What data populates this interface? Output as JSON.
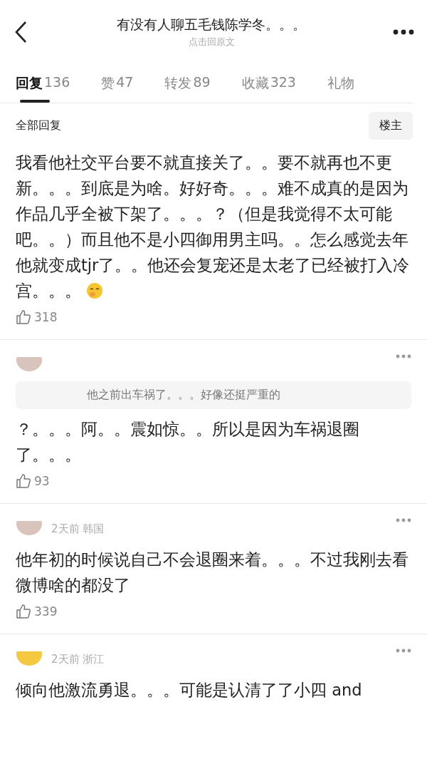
{
  "header": {
    "title": "有没有人聊五毛钱陈学冬。。。",
    "subtitle": "点击回原文"
  },
  "tabs": [
    {
      "label": "回复",
      "count": "136",
      "selected": true
    },
    {
      "label": "赞",
      "count": "47",
      "selected": false
    },
    {
      "label": "转发",
      "count": "89",
      "selected": false
    },
    {
      "label": "收藏",
      "count": "323",
      "selected": false
    },
    {
      "label": "礼物",
      "selected": false
    }
  ],
  "filter": {
    "label": "全部回复",
    "button": "楼主"
  },
  "comments": [
    {
      "text": "我看他社交平台要不就直接关了。。要不就再也不更新。。。到底是为啥。好好奇。。。难不成真的是因为作品几乎全被下架了。。。？（但是我觉得不太可能吧。。）而且他不是小四御用男主吗。。怎么感觉去年他就变成tjr了。。他还会复宠还是太老了已经被打入冷宫。。。",
      "emoji": true,
      "likes": "318"
    },
    {
      "avatar": {
        "color": "#d8c4bd"
      },
      "quote": "他之前出车祸了。。。好像还挺严重的",
      "text": "？。。。阿。。震如惊。。所以是因为车祸退圈了。。。",
      "likes": "93"
    },
    {
      "avatar": {
        "color": "#d8c4bd"
      },
      "meta": "2天前 韩国",
      "text": "他年初的时候说自己不会退圈来着。。。不过我刚去看微博啥的都没了",
      "likes": "339"
    },
    {
      "meta": "2天前 浙江",
      "avatar": {
        "color": "#f5c842"
      },
      "text": "倾向他激流勇退。。。可能是认清了了小四 and"
    }
  ]
}
